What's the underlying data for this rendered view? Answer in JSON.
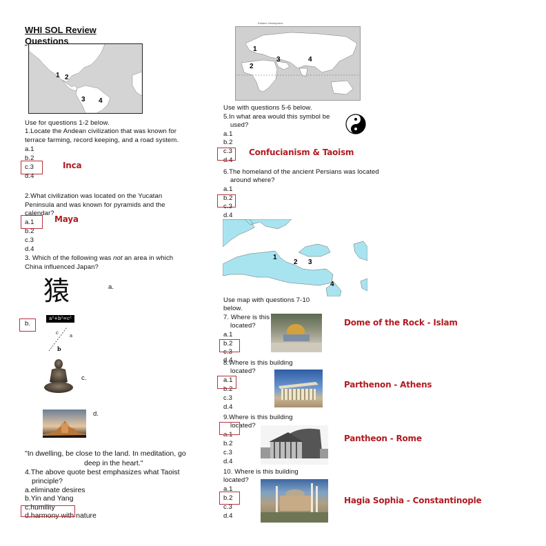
{
  "title": "WHI SOL Review Questions",
  "title_line1": "WHI SOL Review",
  "title_line2": "Questions",
  "maps": {
    "americas": {
      "labels": [
        "1",
        "2",
        "3",
        "4"
      ]
    },
    "eastern": {
      "caption": "Eastern Hemisphere",
      "labels": [
        "1",
        "2",
        "3",
        "4"
      ]
    },
    "mediterranean": {
      "labels": [
        "1",
        "2",
        "3",
        "4"
      ]
    }
  },
  "left": {
    "intro": "Use for questions 1-2 below.",
    "q1": {
      "lines": [
        "1.Locate the Andean civilization that was known for",
        "terrace farming,  record keeping, and a road system."
      ],
      "options": [
        "a.1",
        "b.2",
        "c.3",
        "d.4"
      ],
      "selected": "c.3",
      "answer": "Inca"
    },
    "q2": {
      "lines": [
        "2.What civilization was located on the Yucatan",
        "Peninsula and was  known for pyramids and the",
        "calendar?"
      ],
      "options": [
        "a.1",
        "b.2",
        "c.3",
        "d.4"
      ],
      "selected": "a.1",
      "answer": "Maya"
    },
    "q3": {
      "line1_pre": "3. Which of the following was ",
      "line1_em": "not",
      "line1_post": " an area in which",
      "line2": "China influenced  Japan?",
      "options": [
        "a.",
        "b.",
        "c.",
        "d."
      ],
      "selected": "b.",
      "kanji": "猿",
      "formula": "a²+b²=c²",
      "triangle_labels": [
        "c",
        "a",
        "b"
      ]
    },
    "q4": {
      "quote_line1": "\"In dwelling, be close to the land. In meditation, go",
      "quote_line2": "deep in the heart.\"",
      "question_line1": "4.The above quote best emphasizes what Taoist",
      "question_line2": "principle?",
      "options": [
        "a.eliminate desires",
        "b.Yin and Yang",
        "c.humility",
        "d.harmony with nature"
      ],
      "selected": "c.humility / d.harmony with nature"
    }
  },
  "right": {
    "intro56": "Use with questions 5-6 below.",
    "q5": {
      "line1": "5.In what area would this symbol be",
      "line2": "used?",
      "options": [
        "a.1",
        "b.2",
        "c.3",
        "d.4"
      ],
      "selected": "c.3",
      "answer": "Confucianism & Taoism"
    },
    "q6": {
      "line1": "6.The homeland of the ancient Persians was located",
      "line2": "around where?",
      "options": [
        "a.1",
        "b.2",
        "c.3",
        "d.4"
      ],
      "selected": "b.2"
    },
    "intro710_line1": "Use map with questions 7-10",
    "intro710_line2": "below.",
    "q7": {
      "line1": "7. Where is this",
      "line2": "located?",
      "options": [
        "a.1",
        "b.2",
        "c.3",
        "d.4"
      ],
      "selected": "b.2",
      "answer": "Dome of the Rock - Islam"
    },
    "q8": {
      "line1": "8.Where is this building",
      "line2": "located?",
      "options": [
        "a.1",
        "b.2",
        "c.3",
        "d.4"
      ],
      "selected": "a.1",
      "answer": "Parthenon - Athens"
    },
    "q9": {
      "line1": "9.Where is this building",
      "line2": "located?",
      "options": [
        "a.1",
        "b.2",
        "c.3",
        "d.4"
      ],
      "selected": "a.1",
      "answer": "Pantheon - Rome"
    },
    "q10": {
      "line1": "10. Where is this building",
      "line2": "located?",
      "options": [
        "a.1",
        "b.2",
        "c.3",
        "d.4"
      ],
      "selected": "b.2",
      "answer": "Hagia Sophia - Constantinople"
    }
  },
  "colors": {
    "answer_red": "#b01c22",
    "box_red": "#b5323a",
    "sea_blue": "#a8e4f0",
    "map_gray": "#d4d4d4"
  }
}
